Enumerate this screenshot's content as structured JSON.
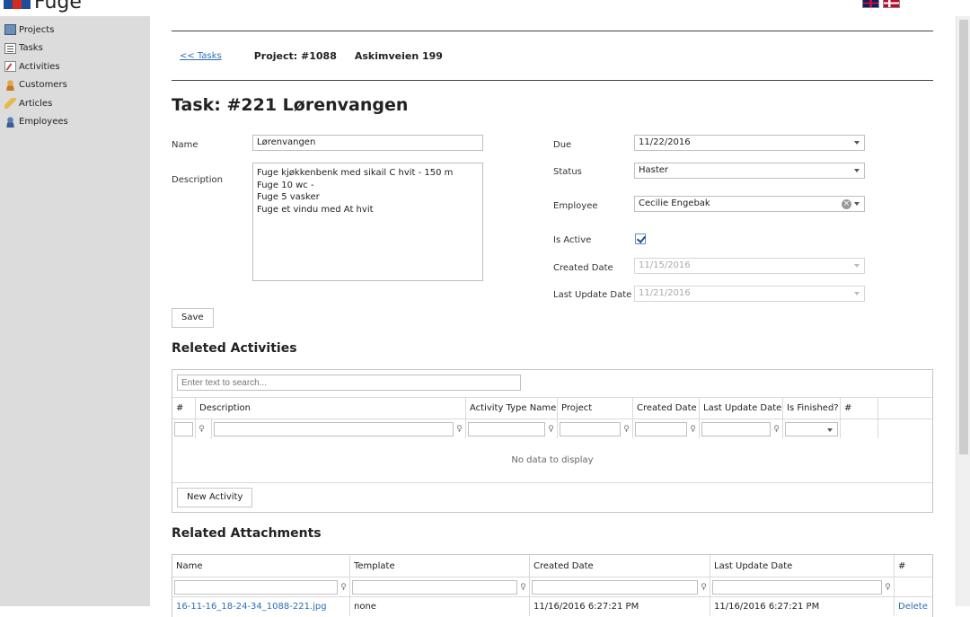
{
  "app": {
    "title": "Fuge"
  },
  "sidebar": {
    "items": [
      {
        "label": "Projects"
      },
      {
        "label": "Tasks"
      },
      {
        "label": "Activities"
      },
      {
        "label": "Customers"
      },
      {
        "label": "Articles"
      },
      {
        "label": "Employees"
      }
    ]
  },
  "breadcrumb": {
    "back_link": "<< Tasks",
    "project": "Project: #1088",
    "project_name": "Askimveien 199"
  },
  "task": {
    "title": "Task: #221 Lørenvangen",
    "name_label": "Name",
    "name_value": "Lørenvangen",
    "description_label": "Description",
    "description_lines": [
      "Fuge kjøkkenbenk med sikail C hvit - 150 m",
      "Fuge 10 wc -",
      "Fuge 5 vasker",
      "Fuge et vindu med At hvit"
    ],
    "due_label": "Due",
    "due_value": "11/22/2016",
    "status_label": "Status",
    "status_value": "Haster",
    "employee_label": "Employee",
    "employee_value": "Cecilie Engebak",
    "is_active_label": "Is Active",
    "is_active": true,
    "created_label": "Created Date",
    "created_value": "11/15/2016",
    "updated_label": "Last Update Date",
    "updated_value": "11/21/2016",
    "save_label": "Save"
  },
  "activities": {
    "title": "Releted Activities",
    "search_placeholder": "Enter text to search...",
    "columns": [
      "#",
      "Description",
      "Activity Type Name",
      "Project",
      "Created Date",
      "Last Update Date",
      "Is Finished?",
      "#"
    ],
    "no_data": "No data to display",
    "new_button": "New Activity"
  },
  "attachments": {
    "title": "Related Attachments",
    "columns": [
      "Name",
      "Template",
      "Created Date",
      "Last Update Date",
      "#"
    ],
    "rows": [
      {
        "name": "16-11-16_18-24-34_1088-221.jpg",
        "template": "none",
        "created": "11/16/2016 6:27:21 PM",
        "updated": "11/16/2016 6:27:21 PM",
        "action": "Delete"
      }
    ]
  }
}
